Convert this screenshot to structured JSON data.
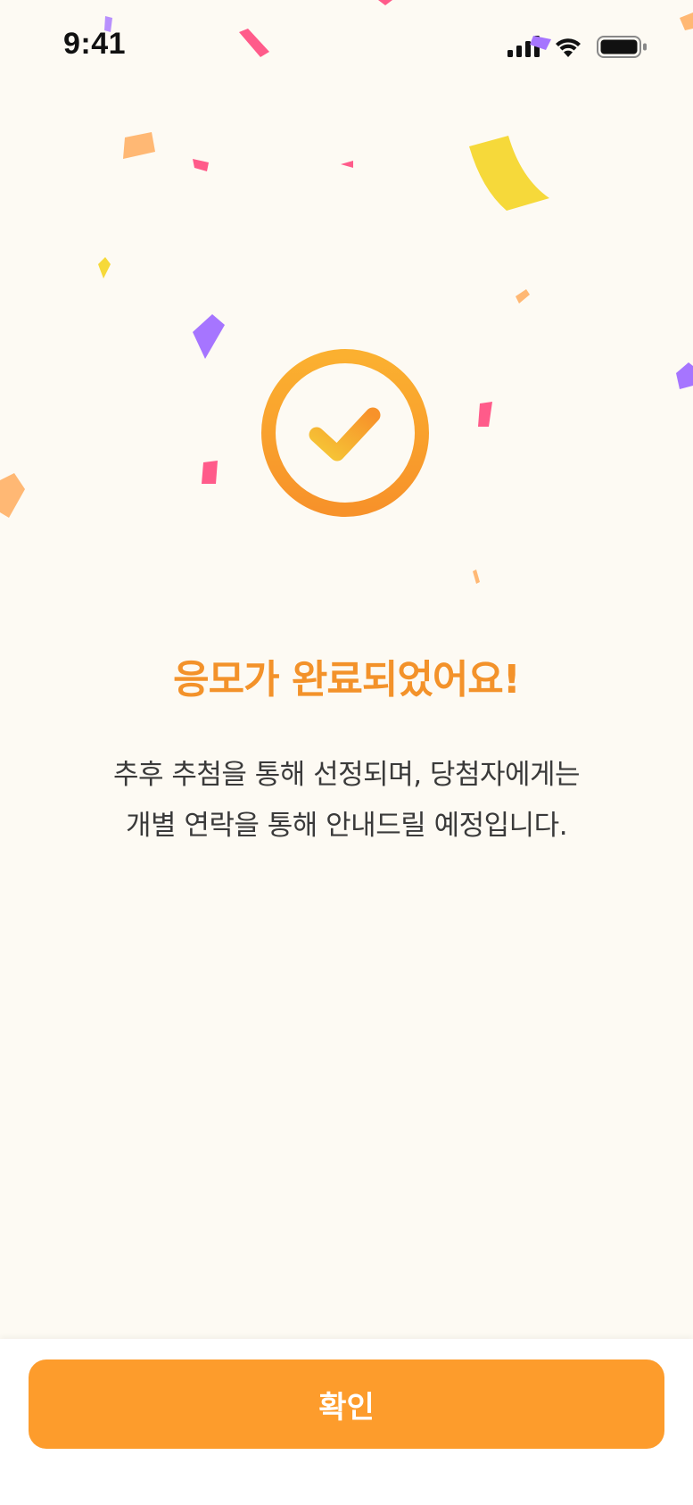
{
  "status_bar": {
    "time": "9:41"
  },
  "result": {
    "title": "응모가 완료되었어요!",
    "description_line1": "추후 추첨을 통해 선정되며, 당첨자에게는",
    "description_line2": "개별 연락을 통해 안내드릴 예정입니다."
  },
  "footer": {
    "confirm_label": "확인"
  },
  "colors": {
    "background": "#fdfaf3",
    "accent": "#f3922a",
    "button": "#fd9c2c",
    "confetti": [
      "#ff5b8a",
      "#a675ff",
      "#ffb874",
      "#f6d93a"
    ]
  }
}
